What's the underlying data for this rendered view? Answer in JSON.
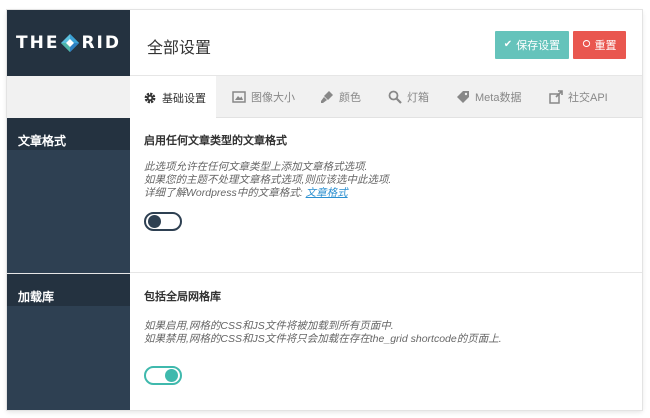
{
  "brand": {
    "logo_left": "THE",
    "logo_right": "RID"
  },
  "header": {
    "title": "全部设置",
    "save_label": "保存设置",
    "reset_label": "重置"
  },
  "tabs": [
    {
      "label": "基础设置",
      "icon": "gear-icon",
      "active": true
    },
    {
      "label": "图像大小",
      "icon": "image-icon",
      "active": false
    },
    {
      "label": "颜色",
      "icon": "brush-icon",
      "active": false
    },
    {
      "label": "灯箱",
      "icon": "search-icon",
      "active": false
    },
    {
      "label": "Meta数据",
      "icon": "tag-icon",
      "active": false
    },
    {
      "label": "社交API",
      "icon": "share-icon",
      "active": false
    }
  ],
  "sections": [
    {
      "sidebar_label": "文章格式",
      "title": "启用任何文章类型的文章格式",
      "desc_line1": "此选项允许在任何文章类型上添加文章格式选项.",
      "desc_line2": "如果您的主题不处理文章格式选项,则应该选中此选项.",
      "desc_line3": "详细了解Wordpress中的文章格式:",
      "desc_link": "文章格式",
      "toggle_on": false
    },
    {
      "sidebar_label": "加载库",
      "title": "包括全局网格库",
      "desc_line1": "如果启用,网格的CSS和JS文件将被加载到所有页面中.",
      "desc_line2": "如果禁用,网格的CSS和JS文件将只会加载在存在the_grid shortcode的页面上.",
      "toggle_on": true
    }
  ],
  "colors": {
    "sidebar": "#2e4052",
    "save": "#65c3bb",
    "reset": "#e9574f",
    "toggle_on": "#3fb9ad"
  }
}
